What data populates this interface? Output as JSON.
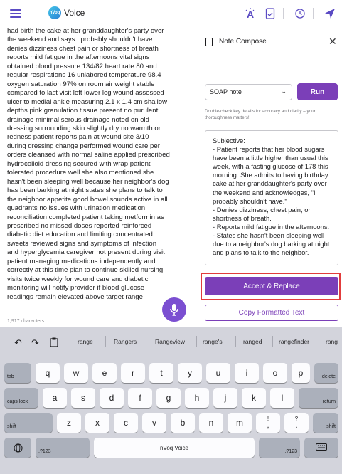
{
  "app": {
    "title": "Voice",
    "logo_text": "nVoq"
  },
  "toolbar": {
    "icons": [
      "menu-icon",
      "magic-wand-icon",
      "document-icon",
      "history-icon",
      "send-icon"
    ],
    "accent_color": "#5b4bc4"
  },
  "document": {
    "text": "had birth the cake at her granddaughter's party over\nthe weekend and says I probably shouldn't have\ndenies dizziness chest pain or shortness of breath\nreports mild fatigue in the afternoons vital signs\nobtained blood pressure 134/82 heart rate 80 and\nregular respirations 16 unlabored temperature 98.4\noxygen saturation 97% on room air weight stable\ncompared to last visit left lower leg wound assessed\nulcer to medial ankle measuring 2.1 x 1.4 cm shallow\ndepths pink granulation tissue present no purulent\ndrainage minimal serous drainage noted on old\ndressing surrounding skin slightly dry no warmth or\nredness patient reports pain at wound site 3/10\nduring dressing change performed wound care per\norders cleansed with normal saline applied prescribed\nhydrocolloid dressing secured with wrap patient\ntolerated procedure well she also mentioned she\nhasn't been sleeping well because her neighbor's dog\nhas been barking at night states she plans to talk to\nthe neighbor appetite good bowel sounds active in all\nquadrants no issues with urination medication\nreconciliation completed patient taking metformin as\nprescribed no missed doses reported reinforced\ndiabetic diet education and limiting concentrated\nsweets reviewed signs and symptoms of infection\nand hyperglycemia caregiver not present during visit\npatient managing medications independently and\ncorrectly at this time plan to continue skilled nursing\nvisits twice weekly for wound care and diabetic\nmonitoring will notify provider if blood glucose\nreadings remain elevated above target range",
    "char_count": "1,917 characters"
  },
  "panel": {
    "title": "Note Compose",
    "template_select": "SOAP note",
    "run_label": "Run",
    "hint": "Double-check key details for accuracy and clarity – your thoroughness matters!",
    "preview": "Subjective:\n- Patient reports that her blood sugars have been a little higher than usual this week, with a fasting glucose of 178 this morning. She admits to having birthday cake at her granddaughter's party over the weekend and acknowledges, \"I probably shouldn't have.\"\n- Denies dizziness, chest pain, or shortness of breath.\n- Reports mild fatigue in the afternoons.\n- States she hasn't been sleeping well due to a neighbor's dog barking at night and plans to talk to the neighbor.",
    "accept_label": "Accept & Replace",
    "copy_label": "Copy Formatted Text",
    "brand_color": "#7b3fb8",
    "highlight_color": "#e23c3c"
  },
  "keyboard": {
    "suggestions": [
      "range",
      "Rangers",
      "Rangeview",
      "range's",
      "ranged",
      "rangefinder",
      "rang"
    ],
    "row1": [
      "q",
      "w",
      "e",
      "r",
      "t",
      "y",
      "u",
      "i",
      "o",
      "p"
    ],
    "row2": [
      "a",
      "s",
      "d",
      "f",
      "g",
      "h",
      "j",
      "k",
      "l"
    ],
    "row3": [
      "z",
      "x",
      "c",
      "v",
      "b",
      "n",
      "m"
    ],
    "punct1": {
      "top": "!",
      "bottom": ","
    },
    "punct2": {
      "top": "?",
      "bottom": "."
    },
    "tab": "tab",
    "delete": "delete",
    "caps_lock": "caps lock",
    "return": "return",
    "shift": "shift",
    "numbers": ".?123",
    "space": "nVoq Voice"
  }
}
